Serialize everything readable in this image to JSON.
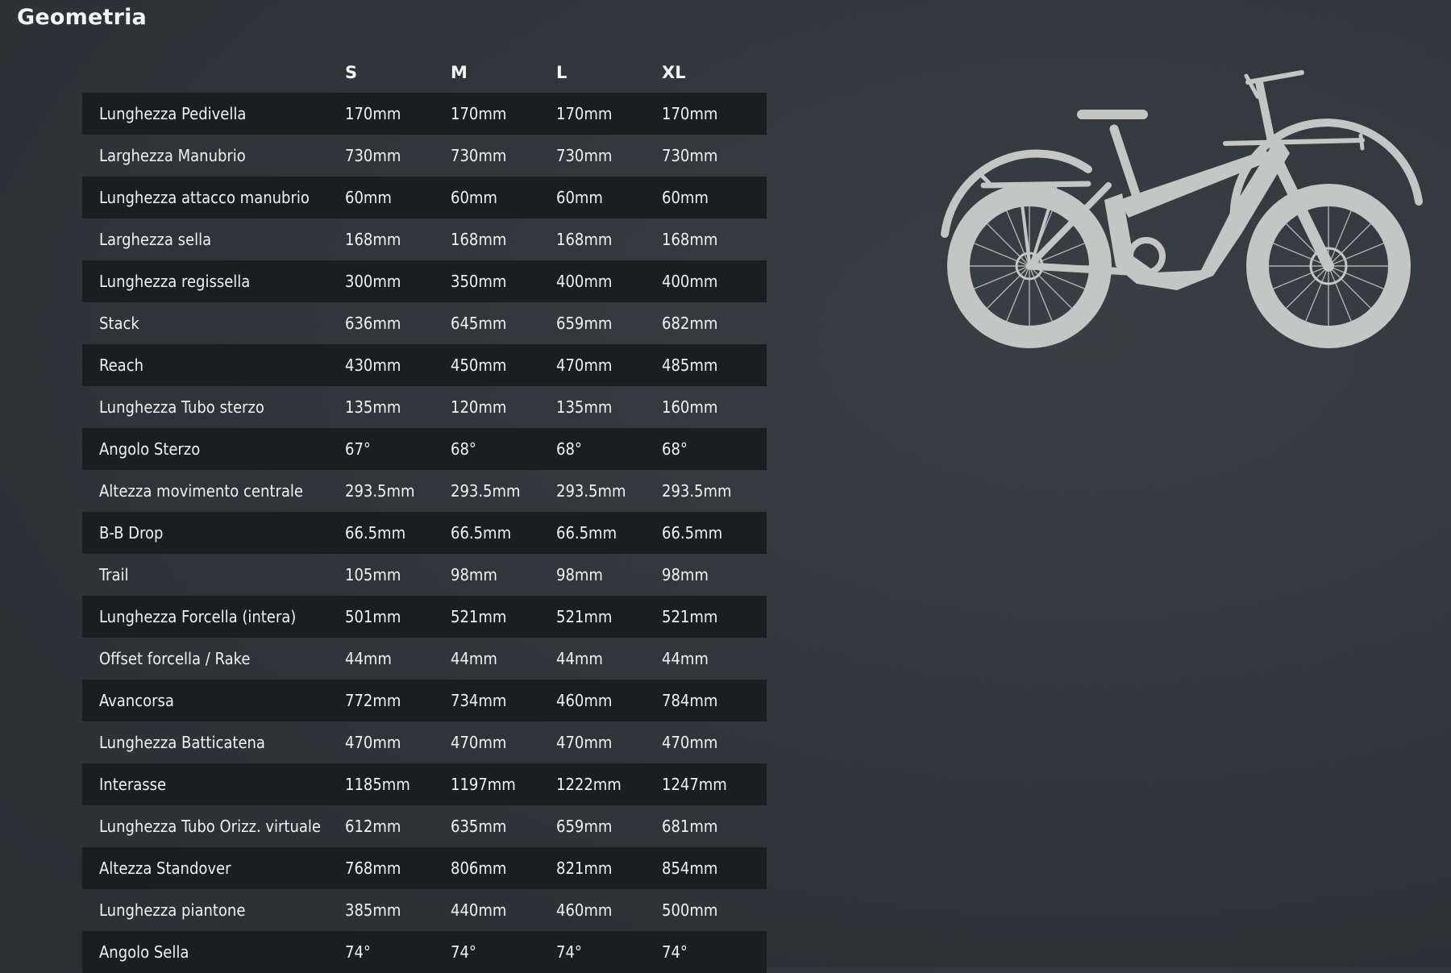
{
  "page": {
    "title": "Geometria"
  },
  "table": {
    "columns": [
      "",
      "S",
      "M",
      "L",
      "XL"
    ],
    "rows": [
      {
        "label": "Lunghezza Pedivella",
        "values": [
          "170mm",
          "170mm",
          "170mm",
          "170mm"
        ]
      },
      {
        "label": "Larghezza Manubrio",
        "values": [
          "730mm",
          "730mm",
          "730mm",
          "730mm"
        ]
      },
      {
        "label": "Lunghezza attacco manubrio",
        "values": [
          "60mm",
          "60mm",
          "60mm",
          "60mm"
        ]
      },
      {
        "label": "Larghezza sella",
        "values": [
          "168mm",
          "168mm",
          "168mm",
          "168mm"
        ]
      },
      {
        "label": "Lunghezza regissella",
        "values": [
          "300mm",
          "350mm",
          "400mm",
          "400mm"
        ]
      },
      {
        "label": "Stack",
        "values": [
          "636mm",
          "645mm",
          "659mm",
          "682mm"
        ]
      },
      {
        "label": "Reach",
        "values": [
          "430mm",
          "450mm",
          "470mm",
          "485mm"
        ]
      },
      {
        "label": "Lunghezza Tubo sterzo",
        "values": [
          "135mm",
          "120mm",
          "135mm",
          "160mm"
        ]
      },
      {
        "label": "Angolo Sterzo",
        "values": [
          "67°",
          "68°",
          "68°",
          "68°"
        ]
      },
      {
        "label": "Altezza movimento centrale",
        "values": [
          "293.5mm",
          "293.5mm",
          "293.5mm",
          "293.5mm"
        ]
      },
      {
        "label": "B-B Drop",
        "values": [
          "66.5mm",
          "66.5mm",
          "66.5mm",
          "66.5mm"
        ]
      },
      {
        "label": "Trail",
        "values": [
          "105mm",
          "98mm",
          "98mm",
          "98mm"
        ]
      },
      {
        "label": "Lunghezza Forcella (intera)",
        "values": [
          "501mm",
          "521mm",
          "521mm",
          "521mm"
        ]
      },
      {
        "label": "Offset forcella / Rake",
        "values": [
          "44mm",
          "44mm",
          "44mm",
          "44mm"
        ]
      },
      {
        "label": "Avancorsa",
        "values": [
          "772mm",
          "734mm",
          "460mm",
          "784mm"
        ]
      },
      {
        "label": "Lunghezza Batticatena",
        "values": [
          "470mm",
          "470mm",
          "470mm",
          "470mm"
        ]
      },
      {
        "label": "Interasse",
        "values": [
          "1185mm",
          "1197mm",
          "1222mm",
          "1247mm"
        ]
      },
      {
        "label": "Lunghezza Tubo Orizz. virtuale",
        "values": [
          "612mm",
          "635mm",
          "659mm",
          "681mm"
        ]
      },
      {
        "label": "Altezza Standover",
        "values": [
          "768mm",
          "806mm",
          "821mm",
          "854mm"
        ]
      },
      {
        "label": "Lunghezza piantone",
        "values": [
          "385mm",
          "440mm",
          "460mm",
          "500mm"
        ]
      },
      {
        "label": "Angolo Sella",
        "values": [
          "74°",
          "74°",
          "74°",
          "74°"
        ]
      }
    ]
  },
  "image": {
    "icon": "e-bike-silhouette-icon",
    "color": "#c4c6c6"
  },
  "colors": {
    "background": "#2f3437",
    "row_dark": "#1b1e20",
    "text": "#f1f1f1"
  }
}
